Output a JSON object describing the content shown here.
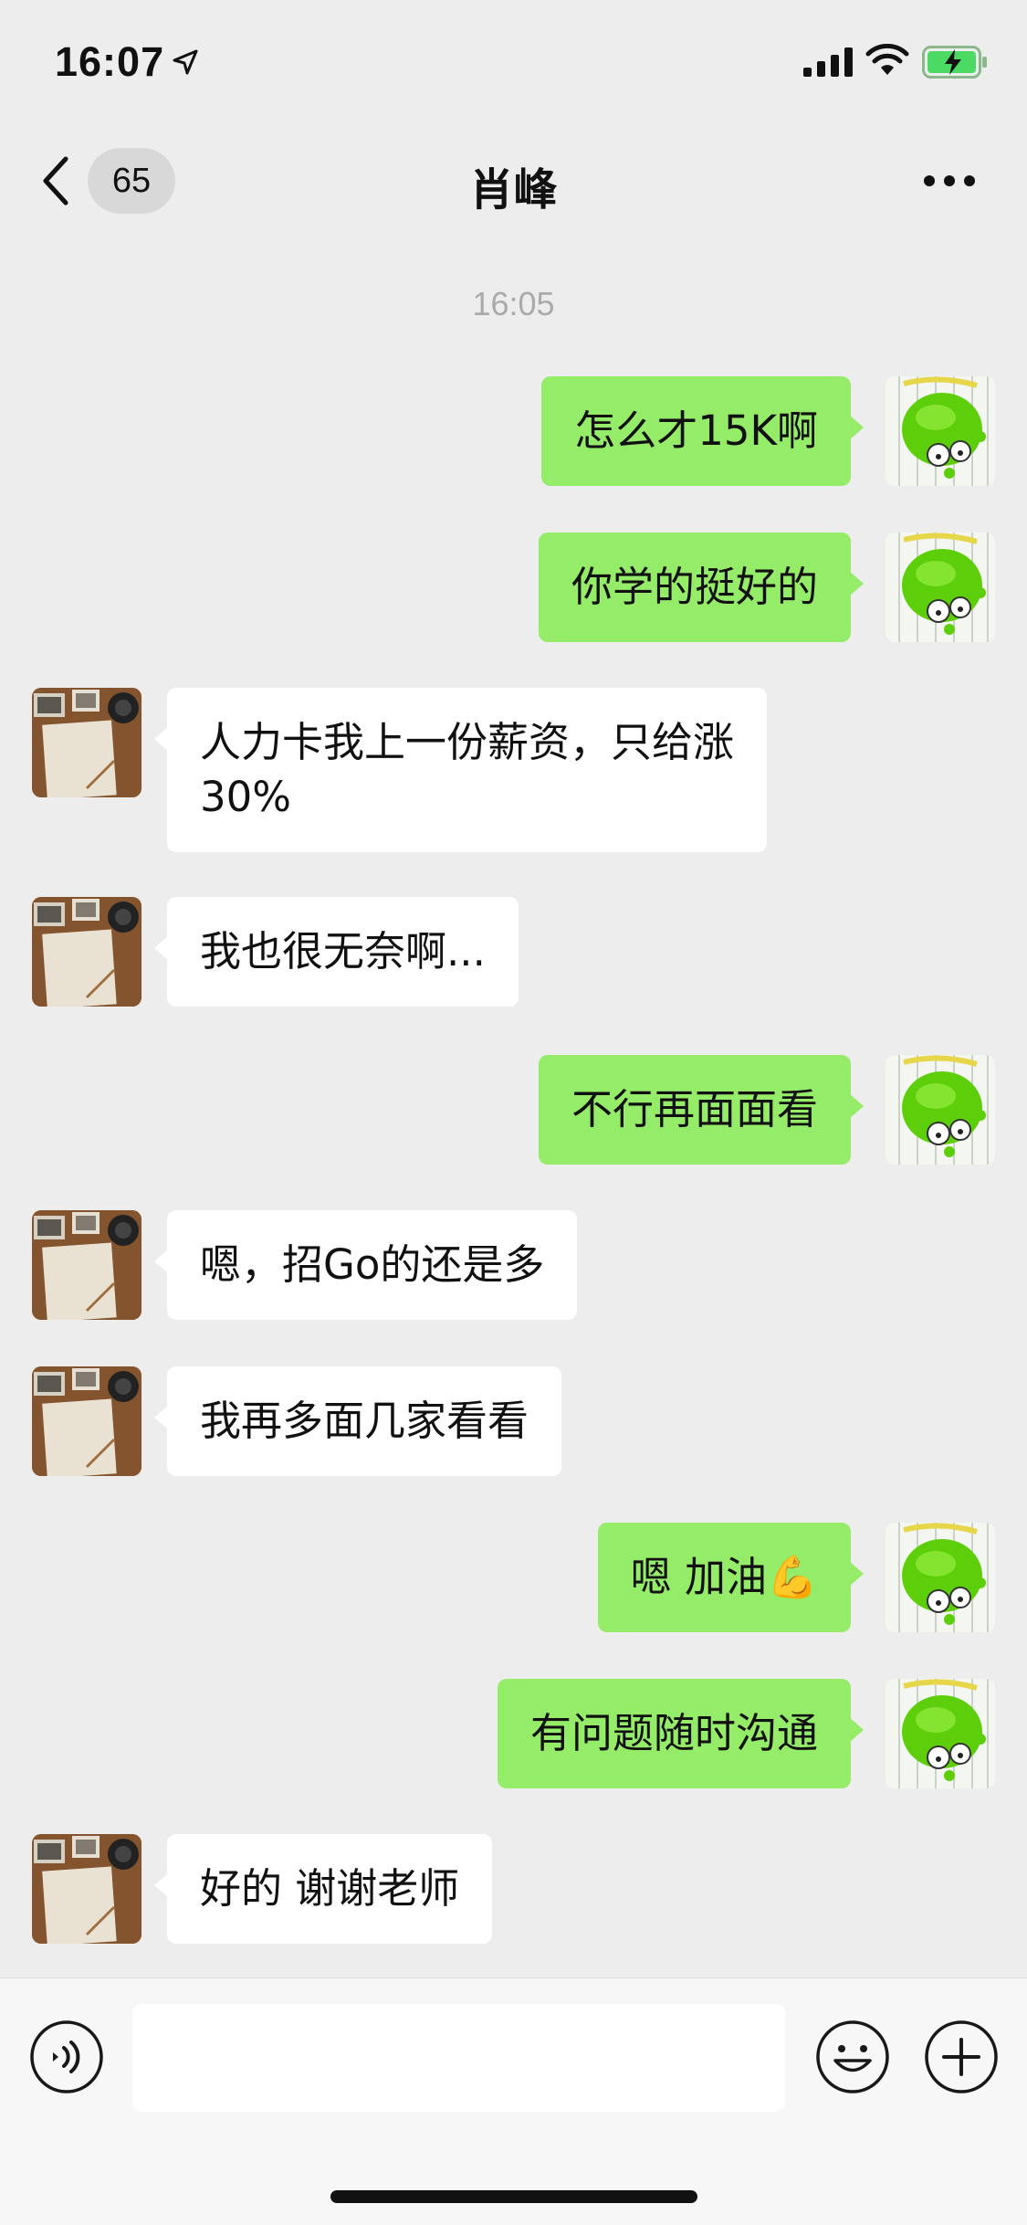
{
  "status_bar": {
    "time": "16:07"
  },
  "nav": {
    "unread_count": "65",
    "title": "肖峰"
  },
  "chat": {
    "timestamp": "16:05",
    "messages": [
      {
        "side": "out",
        "text": "怎么才15K啊"
      },
      {
        "side": "out",
        "text": "你学的挺好的"
      },
      {
        "side": "in",
        "text": "人力卡我上一份薪资，只给涨\n30%"
      },
      {
        "side": "in",
        "text": "我也很无奈啊..."
      },
      {
        "side": "out",
        "text": "不行再面面看"
      },
      {
        "side": "in",
        "text": "嗯，招Go的还是多"
      },
      {
        "side": "in",
        "text": "我再多面几家看看"
      },
      {
        "side": "out",
        "text": "嗯 加油💪"
      },
      {
        "side": "out",
        "text": "有问题随时沟通"
      },
      {
        "side": "in",
        "text": "好的 谢谢老师"
      }
    ]
  },
  "input": {
    "value": ""
  },
  "colors": {
    "background": "#ededed",
    "outgoing_bubble": "#95ec69",
    "incoming_bubble": "#ffffff",
    "timestamp": "#aaaaaa"
  },
  "icons": {
    "back": "chevron-left-icon",
    "more": "more-dots-icon",
    "voice": "voice-icon",
    "emoji": "emoji-icon",
    "plus": "plus-icon",
    "signal": "signal-icon",
    "wifi": "wifi-icon",
    "battery": "battery-charging-icon",
    "location": "location-arrow-icon"
  }
}
